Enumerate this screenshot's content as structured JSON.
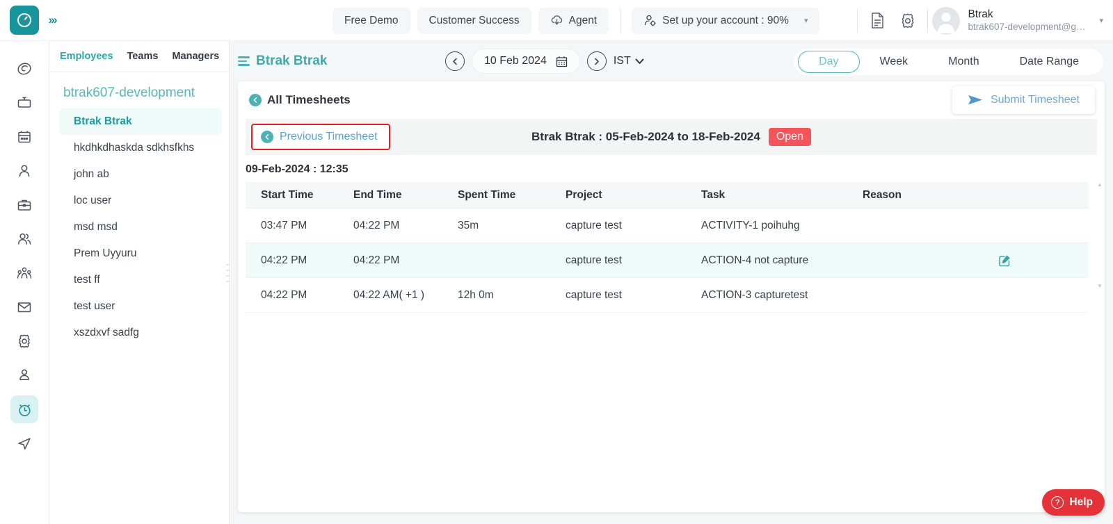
{
  "topbar": {
    "logo_icon": "clock-logo-icon",
    "collapse_icon": "double-chevron-right-icon",
    "buttons": [
      {
        "label": "Free Demo",
        "icon": null
      },
      {
        "label": "Customer Success",
        "icon": null
      },
      {
        "label": "Agent",
        "icon": "cloud-download-icon"
      }
    ],
    "account_setup": {
      "label": "Set up your account : 90%",
      "icon": "user-gear-icon",
      "caret": "▾"
    },
    "doc_icon": "document-icon",
    "settings_icon": "gear-icon",
    "user": {
      "name": "Btrak",
      "email": "btrak607-development@gm...",
      "avatar_icon": "avatar-icon",
      "caret": "▾"
    }
  },
  "rail": {
    "items": [
      {
        "name": "dashboard",
        "icon": "spiral-icon",
        "active": false
      },
      {
        "name": "screens",
        "icon": "tv-icon",
        "active": false
      },
      {
        "name": "calendar",
        "icon": "calendar-icon",
        "active": false
      },
      {
        "name": "profile",
        "icon": "user-icon",
        "active": false
      },
      {
        "name": "briefcase",
        "icon": "briefcase-icon",
        "active": false
      },
      {
        "name": "users",
        "icon": "users-icon",
        "active": false
      },
      {
        "name": "team",
        "icon": "team-group-icon",
        "active": false
      },
      {
        "name": "mail",
        "icon": "envelope-icon",
        "active": false
      },
      {
        "name": "settings",
        "icon": "gear-icon",
        "active": false
      },
      {
        "name": "account",
        "icon": "user-badge-icon",
        "active": false
      },
      {
        "name": "timesheet",
        "icon": "alarm-clock-icon",
        "active": true
      },
      {
        "name": "send",
        "icon": "paper-plane-icon",
        "active": false
      }
    ]
  },
  "left_panel": {
    "tabs": [
      {
        "label": "Employees",
        "active": true
      },
      {
        "label": "Teams",
        "active": false
      },
      {
        "label": "Managers",
        "active": false
      }
    ],
    "org": "btrak607-development",
    "items": [
      {
        "label": "Btrak Btrak",
        "active": true
      },
      {
        "label": "hkdhkdhaskda sdkhsfkhs",
        "active": false
      },
      {
        "label": "john ab",
        "active": false
      },
      {
        "label": "loc user",
        "active": false
      },
      {
        "label": "msd msd",
        "active": false
      },
      {
        "label": "Prem Uyyuru",
        "active": false
      },
      {
        "label": "test ff",
        "active": false
      },
      {
        "label": "test user",
        "active": false
      },
      {
        "label": "xszdxvf sadfg",
        "active": false
      }
    ]
  },
  "main": {
    "title": "Btrak Btrak",
    "menu_icon": "hamburger-icon",
    "date_nav": {
      "prev_icon": "chevron-left-circle-icon",
      "next_icon": "chevron-right-circle-icon",
      "date": "10 Feb 2024",
      "calendar_icon": "calendar-icon",
      "timezone": "IST",
      "timezone_caret": "⌄"
    },
    "view_tabs": [
      {
        "label": "Day",
        "active": true
      },
      {
        "label": "Week",
        "active": false
      },
      {
        "label": "Month",
        "active": false
      },
      {
        "label": "Date Range",
        "active": false
      }
    ],
    "back_link": {
      "label": "All Timesheets",
      "icon": "back-circle-icon"
    },
    "submit_button": {
      "label": "Submit Timesheet",
      "icon": "send-icon"
    },
    "timesheet_bar": {
      "previous_button": {
        "label": "Previous Timesheet",
        "icon": "back-circle-icon"
      },
      "title": "Btrak Btrak : 05-Feb-2024 to 18-Feb-2024",
      "status": "Open",
      "status_color": "#f3555a",
      "highlight_color": "#ec1c24"
    },
    "day_label": "09-Feb-2024 : 12:35",
    "table": {
      "columns": [
        "Start Time",
        "End Time",
        "Spent Time",
        "Project",
        "Task",
        "Reason",
        ""
      ],
      "rows": [
        {
          "start_time": "03:47 PM",
          "end_time": "04:22 PM",
          "spent_time": "35m",
          "project": "capture test",
          "task": "ACTIVITY-1 poihuhg",
          "reason": "",
          "highlighted": false,
          "edit_icon": ""
        },
        {
          "start_time": "04:22 PM",
          "end_time": "04:22 PM",
          "spent_time": "",
          "project": "capture test",
          "task": "ACTION-4 not capture",
          "reason": "",
          "highlighted": true,
          "edit_icon": "edit-pencil-icon"
        },
        {
          "start_time": "04:22 PM",
          "end_time": "04:22 AM( +1 )",
          "spent_time": "12h 0m",
          "project": "capture test",
          "task": "ACTION-3 capturetest",
          "reason": "",
          "highlighted": false,
          "edit_icon": ""
        }
      ]
    },
    "help_button": {
      "label": "Help",
      "icon": "question-circle-icon"
    }
  }
}
